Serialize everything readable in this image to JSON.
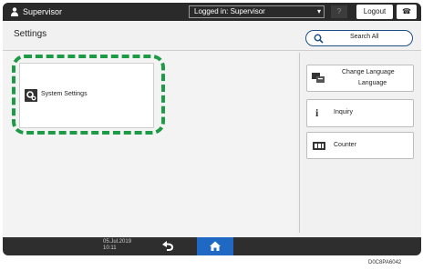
{
  "topbar": {
    "user_name": "Supervisor",
    "login_status": "Logged in: Supervisor",
    "help_label": "?",
    "logout_label": "Logout",
    "phone_icon_label": "☎"
  },
  "page": {
    "title": "Settings",
    "search_all_label": "Search All"
  },
  "main": {
    "system_settings_label": "System Settings"
  },
  "side_cards": {
    "change_language_line1": "Change Language",
    "change_language_line2": "Language",
    "inquiry_label": "Inquiry",
    "counter_label": "Counter"
  },
  "bottombar": {
    "date": "05.Jul.2019",
    "time": "10:11"
  },
  "figure_code": "D0C8PA6042",
  "colors": {
    "accent": "#1f68c4",
    "highlight": "#1d9a45",
    "bar": "#2a2a2a"
  }
}
